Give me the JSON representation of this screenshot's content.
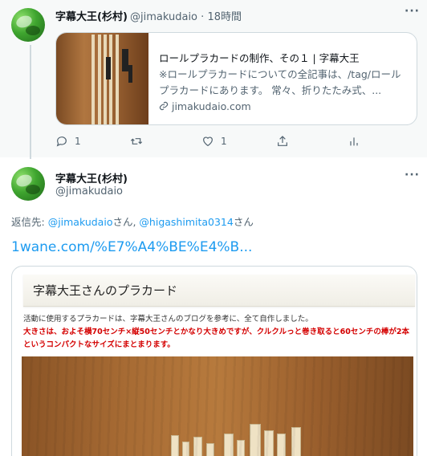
{
  "previous_tweet": {
    "display_name": "字幕大王(杉村)",
    "handle": "@jimakudaio",
    "separator": "·",
    "time": "18時間",
    "link_card": {
      "title": "ロールプラカードの制作、その１ | 字幕大王",
      "description": "※ロールプラカードについての全記事は、/tag/ロールプラカードにあります。 常々、折りたたみ式、...",
      "domain": "jimakudaio.com",
      "link_icon": "link-icon"
    },
    "actions": {
      "reply_count": "1",
      "retweet_count": "",
      "like_count": "1"
    }
  },
  "main_tweet": {
    "display_name": "字幕大王(杉村)",
    "handle": "@jimakudaio",
    "reply_prefix": "返信先: ",
    "reply_mentions": [
      {
        "mention": "@jimakudaio",
        "suffix": "さん, "
      },
      {
        "mention": "@higashimita0314",
        "suffix": "さん"
      }
    ],
    "link_text": "1wane.com/%E7%A4%BE%E4%B...",
    "image": {
      "header": "字幕大王さんのプラカード",
      "caption_line1": "活動に使用するプラカードは、字幕大王さんのブログを参考に、全て自作しました。",
      "caption_line2": "大きさは、およそ横70センチ×縦50センチとかなり大きめですが、クルクルっと巻き取ると60センチの棒が2本",
      "caption_line3": "というコンパクトなサイズにまとまります。"
    }
  },
  "colors": {
    "accent": "#1d9bf0",
    "secondary_text": "#536471",
    "caption_red": "#d40000"
  }
}
